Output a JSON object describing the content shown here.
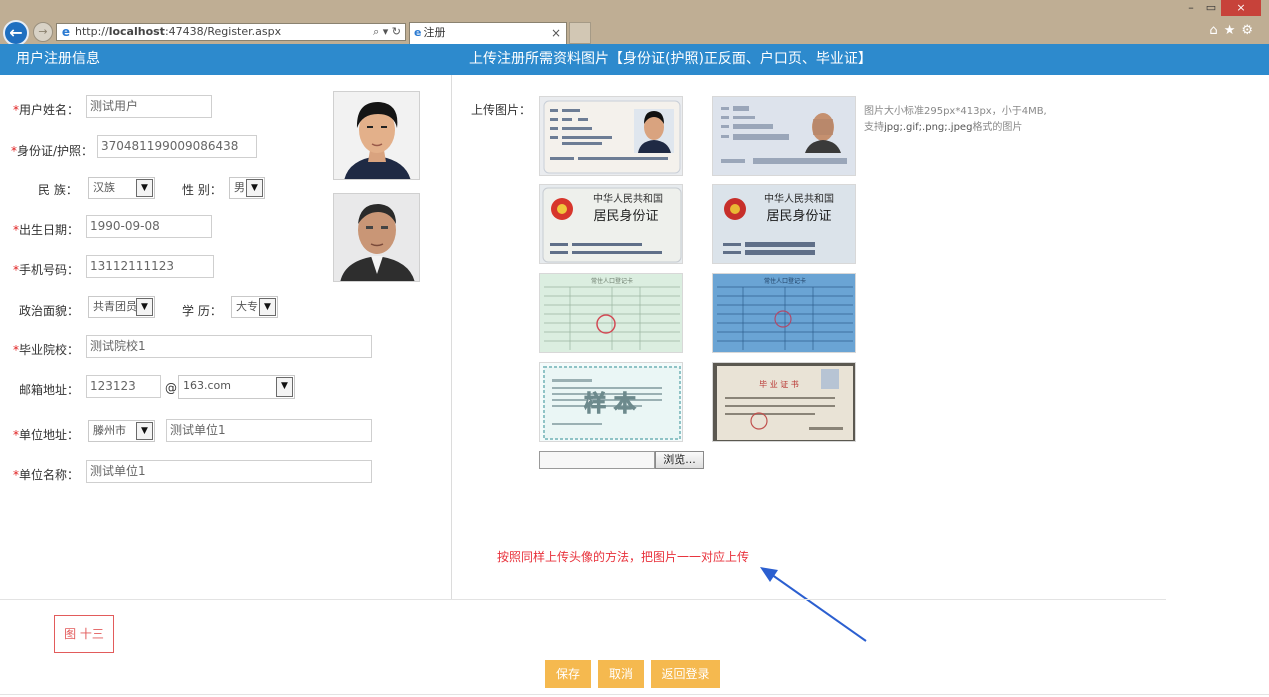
{
  "browser": {
    "url": "http://localhost:47438/Register.aspx",
    "url_host": "localhost",
    "url_prefix": "http://",
    "url_suffix": ":47438/Register.aspx",
    "address_controls": "⌕ ▾ ↻",
    "tab_title": "注册",
    "tab_close": "×",
    "window_controls": [
      "–",
      "▭",
      "×"
    ],
    "tool_icons": [
      "home-icon",
      "star-icon",
      "gear-icon"
    ]
  },
  "header": {
    "left_title": "用户注册信息",
    "right_title": "上传注册所需资料图片【身份证(护照)正反面、户口页、毕业证】"
  },
  "form": {
    "required_mark": "*",
    "name": {
      "label": "用户姓名：",
      "value": "测试用户"
    },
    "id_card": {
      "label": "身份证/护照：",
      "value": "370481199009086438"
    },
    "ethnicity": {
      "label": "民 族：",
      "value": "汉族"
    },
    "gender": {
      "label": "性 别：",
      "value": "男"
    },
    "birth_date": {
      "label": "出生日期：",
      "value": "1990-09-08"
    },
    "phone": {
      "label": "手机号码：",
      "value": "13112111123"
    },
    "politics": {
      "label": "政治面貌：",
      "value": "共青团员"
    },
    "education": {
      "label": "学 历：",
      "value": "大专"
    },
    "school": {
      "label": "毕业院校：",
      "value": "测试院校1"
    },
    "email": {
      "label": "邮箱地址：",
      "user": "123123",
      "at": "@",
      "domain": "163.com"
    },
    "work_address": {
      "label": "单位地址：",
      "city": "滕州市",
      "detail": "测试单位1"
    },
    "work_name": {
      "label": "单位名称：",
      "value": "测试单位1"
    }
  },
  "upload": {
    "label": "上传图片：",
    "hint_line1": "图片大小标准295px*413px，小于4MB,",
    "hint_line2_prefix": "支持",
    "hint_line2_formats": "jpg;.gif;.png;.jpeg",
    "hint_line2_suffix": "格式的图片",
    "browse_label": "浏览...",
    "id_front_title": "中华人民共和国",
    "id_front_subtitle": "居民身份证",
    "household_title": "常住人口登记卡",
    "diploma_title": "毕 业 证 书",
    "sample_stamp": "样 本"
  },
  "annotation": {
    "note": "按照同样上传头像的方法，把图片一一对应上传",
    "figure_label": "图 十三"
  },
  "buttons": {
    "save": "保存",
    "cancel": "取消",
    "back_login": "返回登录"
  },
  "colors": {
    "header_blue": "#2d8acd",
    "button_orange": "#f5b94f",
    "required_red": "#e02020",
    "annotation_red": "#e8323c",
    "arrow_blue": "#2b5fd0"
  }
}
